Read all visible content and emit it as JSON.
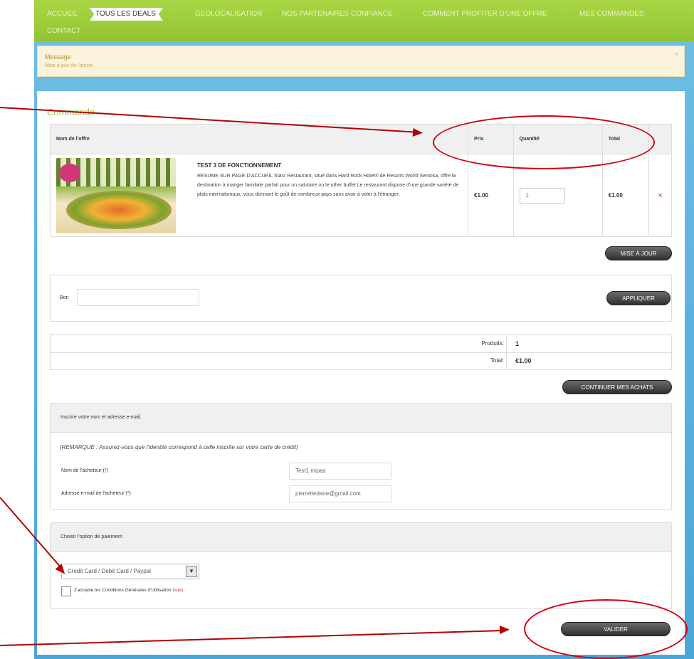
{
  "nav": {
    "items": [
      "ACCUEIL",
      "TOUS LES DEALS",
      "GEOLOCALISATION",
      "NOS PARTENAIRES CONFIANCE",
      "COMMENT PROFITER D'UNE OFFRE",
      "MES COMMANDES",
      "CONTACT"
    ],
    "active": "TOUS LES DEALS"
  },
  "message": {
    "title": "Message",
    "text": "Mise à jour de l'article",
    "close": "×"
  },
  "order": {
    "title": "Commande",
    "headers": {
      "name": "Nom de l'offre",
      "price": "Prix",
      "quantity": "Quantité",
      "total": "Total"
    },
    "item": {
      "title": "TEST 3 DE FONCTIONNEMENT",
      "description": "RESUME SUR PAGE D'ACCUEIL Starz Restaurant, situé dans Hard Rock Hotel® de Resorts World Sentosa, offre la destination à manger familiale parfait pour un salutaire ou le other buffet.Le restaurant dispose d'une grande variété de plats internationaux, vous donnant le goût de nombreux pays sans avoir à voler à l'étranger.",
      "price": "€1.00",
      "quantity": "1",
      "total": "€1.00",
      "remove": "×"
    },
    "update_button": "MISE À JOUR"
  },
  "coupon": {
    "label": "Bon",
    "value": "",
    "apply_button": "APPLIQUER"
  },
  "summary": {
    "products_label": "Produits:",
    "products_value": "1",
    "total_label": "Total:",
    "total_value": "€1.00",
    "continue_button": "CONTINUER MES ACHATS"
  },
  "buyer": {
    "section_title": "Inscrire votre nom et adresse e-mail.",
    "note": "(REMARQUE : Assurez-vous que l'identité correspond à celle inscrite sur votre carte de crédit)",
    "name_label": "Nom de l'acheteur (*)",
    "name_value": "Test1 mipas",
    "email_label": "Adresse e-mail de l'acheteur (*)",
    "email_value": "pierrettedane@gmail.com"
  },
  "payment": {
    "section_title": "Choisir l'option de paiement",
    "selected": "Credit Card / Debit Card / Paypal",
    "terms_label": "J'accepte les Conditions Générales d'Utilisation",
    "terms_link": "(sue)",
    "terms_checked": false,
    "submit_button": "VALIDER"
  },
  "colors": {
    "nav_green": "#9ccc3c",
    "commande_green": "#9bc645",
    "annotation_red": "#b40000",
    "page_blue": "#4aa6d8"
  }
}
